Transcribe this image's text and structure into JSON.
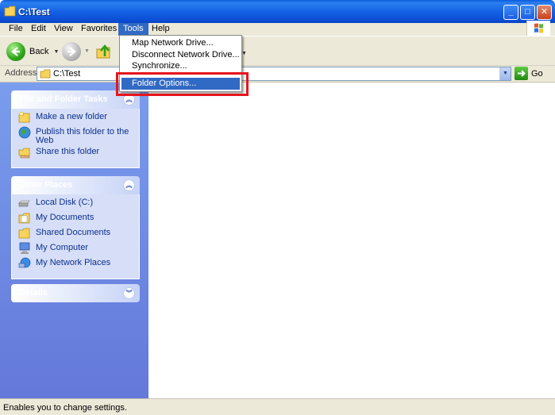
{
  "window": {
    "title": "C:\\Test"
  },
  "menubar": {
    "items": [
      "File",
      "Edit",
      "View",
      "Favorites",
      "Tools",
      "Help"
    ],
    "active": "Tools"
  },
  "toolbar": {
    "back_label": "Back"
  },
  "address": {
    "label": "Address",
    "value": "C:\\Test",
    "go_label": "Go"
  },
  "tools_menu": {
    "items": [
      "Map Network Drive...",
      "Disconnect Network Drive...",
      "Synchronize...",
      "Folder Options..."
    ],
    "highlighted": "Folder Options..."
  },
  "sidebar": {
    "file_tasks": {
      "title": "File and Folder Tasks",
      "items": [
        "Make a new folder",
        "Publish this folder to the Web",
        "Share this folder"
      ]
    },
    "other_places": {
      "title": "Other Places",
      "items": [
        "Local Disk (C:)",
        "My Documents",
        "Shared Documents",
        "My Computer",
        "My Network Places"
      ]
    },
    "details": {
      "title": "Details"
    }
  },
  "status": {
    "text": "Enables you to change settings."
  },
  "colors": {
    "accent": "#316ac5",
    "titlebar": "#0a5bdc",
    "sidebar": "#6f8de0",
    "annotation": "#e8141b"
  }
}
